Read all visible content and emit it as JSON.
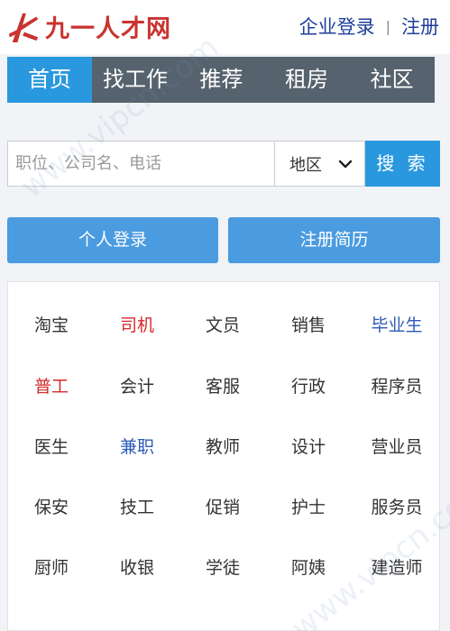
{
  "header": {
    "logo_text": "九一人才网",
    "company_login": "企业登录",
    "separator": "|",
    "register": "注册"
  },
  "nav": {
    "items": [
      {
        "label": "首页",
        "active": true
      },
      {
        "label": "找工作"
      },
      {
        "label": "推荐"
      },
      {
        "label": "租房"
      },
      {
        "label": "社区"
      }
    ]
  },
  "search": {
    "placeholder": "职位、公司名、电话",
    "region": "地区",
    "button": "搜 索"
  },
  "buttons": {
    "personal_login": "个人登录",
    "register_resume": "注册简历"
  },
  "jobs": {
    "rows": [
      [
        {
          "label": "淘宝"
        },
        {
          "label": "司机",
          "color": "red"
        },
        {
          "label": "文员"
        },
        {
          "label": "销售"
        },
        {
          "label": "毕业生",
          "color": "blue"
        }
      ],
      [
        {
          "label": "普工",
          "color": "red"
        },
        {
          "label": "会计"
        },
        {
          "label": "客服"
        },
        {
          "label": "行政"
        },
        {
          "label": "程序员"
        }
      ],
      [
        {
          "label": "医生"
        },
        {
          "label": "兼职",
          "color": "blue"
        },
        {
          "label": "教师"
        },
        {
          "label": "设计"
        },
        {
          "label": "营业员"
        }
      ],
      [
        {
          "label": "保安"
        },
        {
          "label": "技工"
        },
        {
          "label": "促销"
        },
        {
          "label": "护士"
        },
        {
          "label": "服务员"
        }
      ],
      [
        {
          "label": "厨师"
        },
        {
          "label": "收银"
        },
        {
          "label": "学徒"
        },
        {
          "label": "阿姨"
        },
        {
          "label": "建造师"
        }
      ]
    ]
  },
  "colors": {
    "accent": "#2a98de",
    "nav_bg": "#56626d",
    "brand_red": "#c9332f",
    "link_blue": "#1f3f9a"
  },
  "watermark": "www.vipcn.com"
}
